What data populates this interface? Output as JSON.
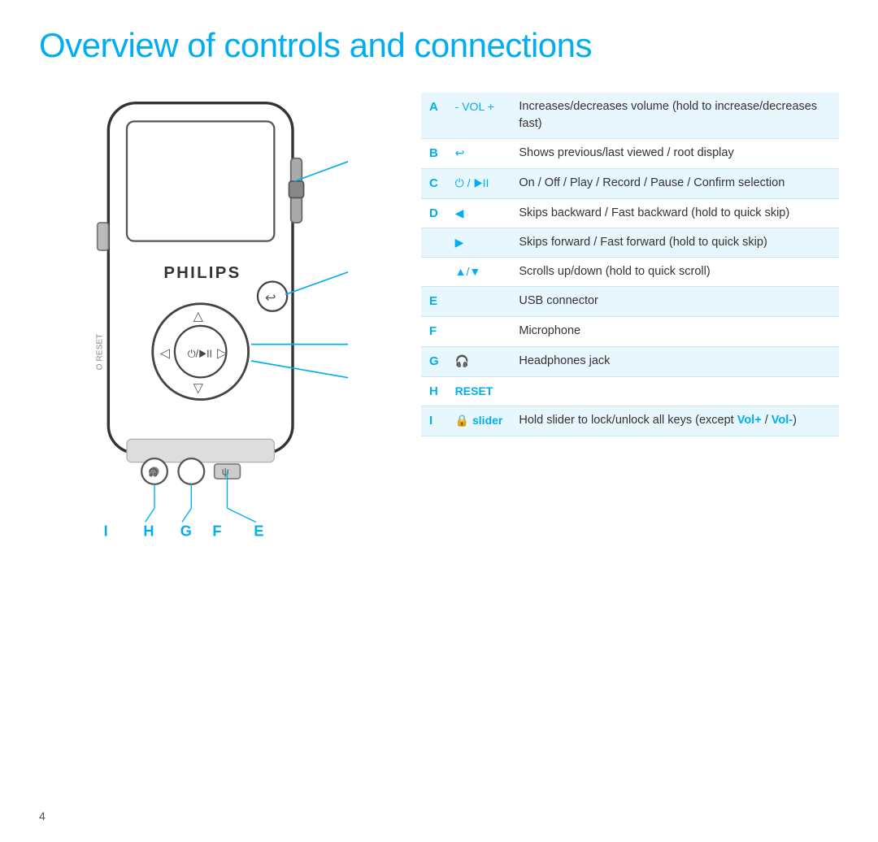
{
  "page": {
    "title": "Overview of controls and connections",
    "page_number": "4"
  },
  "controls": [
    {
      "letter": "A",
      "icon": "- VOL +",
      "description": "Increases/decreases volume (hold to increase/decreases fast)"
    },
    {
      "letter": "B",
      "icon": "↩",
      "description": "Shows previous/last viewed / root display"
    },
    {
      "letter": "C",
      "icon": "⏻ / ▶II",
      "description": "On / Off / Play / Record / Pause / Confirm selection"
    },
    {
      "letter": "D",
      "icon": "◀",
      "description": "Skips backward / Fast backward (hold to quick skip)"
    },
    {
      "letter": "",
      "icon": "▶",
      "description": "Skips forward / Fast forward (hold to quick skip)"
    },
    {
      "letter": "",
      "icon": "▲/▼",
      "description": "Scrolls up/down (hold to quick scroll)"
    },
    {
      "letter": "E",
      "icon": "",
      "description": "USB connector"
    },
    {
      "letter": "F",
      "icon": "",
      "description": "Microphone"
    },
    {
      "letter": "G",
      "icon": "🎧",
      "description": "Headphones jack"
    },
    {
      "letter": "H",
      "icon": "RESET",
      "description": ""
    },
    {
      "letter": "I",
      "icon": "🔒 slider",
      "description": "Hold slider to lock/unlock all keys (except Vol+ / Vol-)"
    }
  ],
  "bottom_labels": {
    "i": "I",
    "h": "H",
    "g": "G",
    "f": "F",
    "e": "E"
  }
}
